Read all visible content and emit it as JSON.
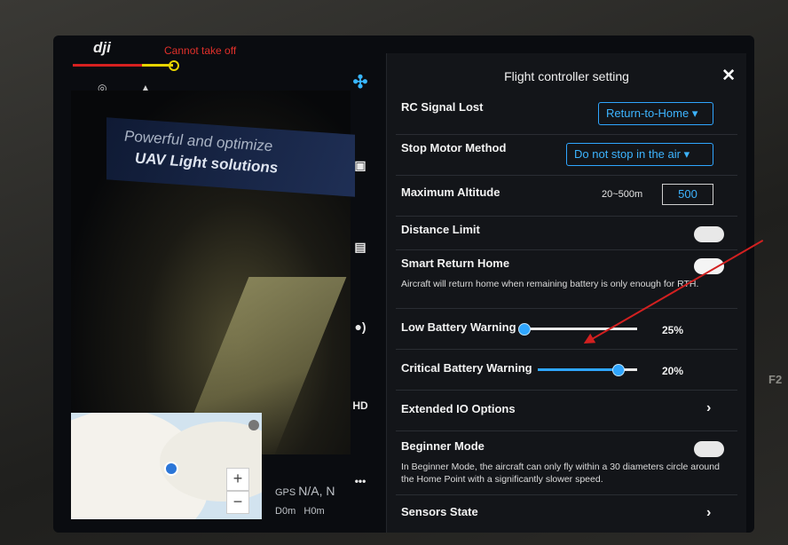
{
  "status": {
    "logo": "dji",
    "takeoff_warning": "Cannot take off"
  },
  "camera": {
    "banner_line1": "Powerful and optimize",
    "banner_line2": "UAV Light solutions"
  },
  "map": {
    "zoom_in": "+",
    "zoom_out": "−"
  },
  "telemetry": {
    "gps_label": "GPS",
    "gps_value": "N/A, N",
    "d_label": "D",
    "d_value": "0",
    "d_unit": "m",
    "h_label": "H",
    "h_value": "0",
    "h_unit": "m"
  },
  "toolbar": {
    "hd_label": "HD",
    "more_label": "•••"
  },
  "panel": {
    "title": "Flight controller setting",
    "close": "✕",
    "rc_signal_lost": {
      "label": "RC Signal Lost",
      "value": "Return-to-Home"
    },
    "stop_motor": {
      "label": "Stop Motor Method",
      "value": "Do not stop in the air"
    },
    "max_altitude": {
      "label": "Maximum Altitude",
      "range": "20~500m",
      "value": "500"
    },
    "distance_limit": {
      "label": "Distance Limit",
      "state": "off"
    },
    "smart_rth": {
      "label": "Smart Return Home",
      "state": "on",
      "description": "Aircraft will return home when remaining battery is only enough for RTH."
    },
    "low_battery": {
      "label": "Low Battery Warning",
      "value_text": "25%",
      "value": 0.0
    },
    "critical_battery": {
      "label": "Critical Battery Warning",
      "value_text": "20%",
      "value": 0.8
    },
    "extended_io": {
      "label": "Extended IO Options",
      "chevron": "›"
    },
    "beginner_mode": {
      "label": "Beginner Mode",
      "state": "off",
      "description": "In Beginner Mode, the aircraft can only fly within a 30 diameters circle around the Home Point with a significantly slower speed."
    },
    "sensors_state": {
      "label": "Sensors State",
      "chevron": "›"
    }
  },
  "device_label": "F2",
  "colors": {
    "accent": "#2fa6ff",
    "warning": "#e0302a",
    "panel_bg": "#131519"
  }
}
